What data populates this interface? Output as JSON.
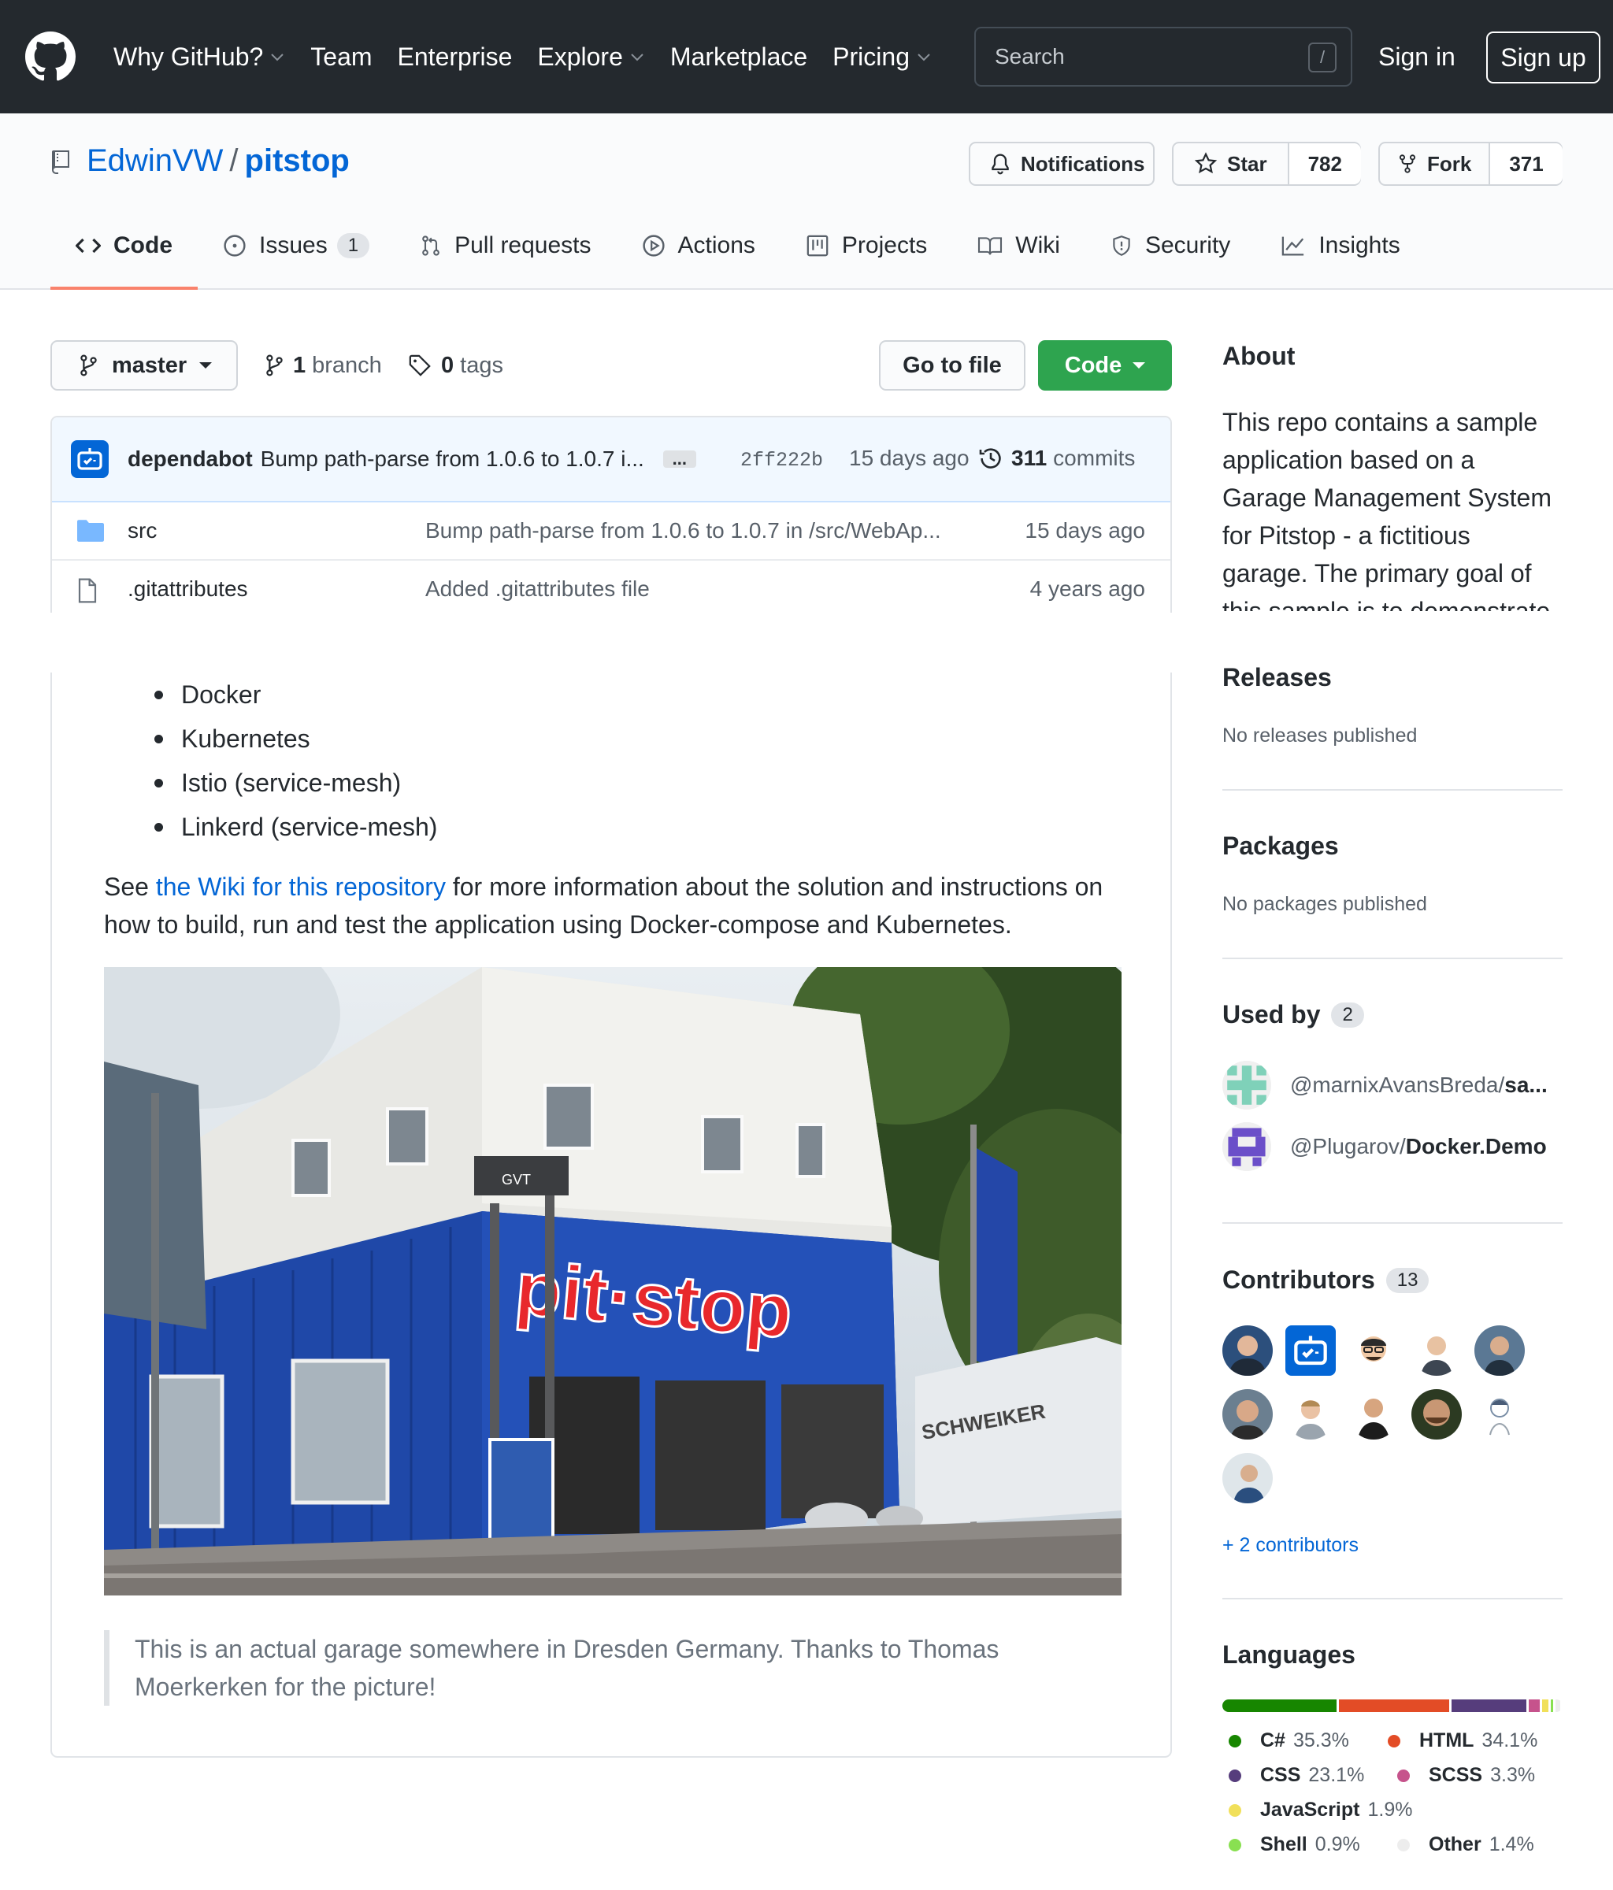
{
  "header": {
    "nav": [
      {
        "label": "Why GitHub?",
        "dropdown": true
      },
      {
        "label": "Team",
        "dropdown": false
      },
      {
        "label": "Enterprise",
        "dropdown": false
      },
      {
        "label": "Explore",
        "dropdown": true
      },
      {
        "label": "Marketplace",
        "dropdown": false
      },
      {
        "label": "Pricing",
        "dropdown": true
      }
    ],
    "search_placeholder": "Search",
    "search_shortcut": "/",
    "sign_in": "Sign in",
    "sign_up": "Sign up"
  },
  "repo": {
    "owner": "EdwinVW",
    "separator": "/",
    "name": "pitstop",
    "notifications_label": "Notifications",
    "star_label": "Star",
    "star_count": "782",
    "fork_label": "Fork",
    "fork_count": "371"
  },
  "tabs": [
    {
      "label": "Code",
      "icon": "code-icon"
    },
    {
      "label": "Issues",
      "icon": "issue-icon",
      "counter": "1"
    },
    {
      "label": "Pull requests",
      "icon": "pull-request-icon"
    },
    {
      "label": "Actions",
      "icon": "play-icon"
    },
    {
      "label": "Projects",
      "icon": "project-icon"
    },
    {
      "label": "Wiki",
      "icon": "book-icon"
    },
    {
      "label": "Security",
      "icon": "shield-icon"
    },
    {
      "label": "Insights",
      "icon": "graph-icon"
    }
  ],
  "branch_bar": {
    "branch": "master",
    "branch_count": "1",
    "branch_word": "branch",
    "tag_count": "0",
    "tag_word": "tags",
    "goto_file": "Go to file",
    "code_button": "Code"
  },
  "latest_commit": {
    "author": "dependabot",
    "message": "Bump path-parse from 1.0.6 to 1.0.7 i...",
    "ellipsis": "...",
    "sha": "2ff222b",
    "time": "15 days ago",
    "commit_count": "311",
    "commit_word": "commits"
  },
  "files": [
    {
      "type": "folder",
      "name": "src",
      "message": "Bump path-parse from 1.0.6 to 1.0.7 in /src/WebAp...",
      "age": "15 days ago"
    },
    {
      "type": "file",
      "name": ".gitattributes",
      "message": "Added .gitattributes file",
      "age": "4 years ago"
    }
  ],
  "readme": {
    "list": [
      "Docker",
      "Kubernetes",
      "Istio (service-mesh)",
      "Linkerd (service-mesh)"
    ],
    "para_before": "See ",
    "para_link": "the Wiki for this repository",
    "para_after": " for more information about the solution and instructions on how to build, run and test the application using Docker-compose and Kubernetes.",
    "photo_sign": "pit·stop",
    "photo_truck": "SCHWEIKER",
    "photo_box": "GVT",
    "quote": "This is an actual garage somewhere in Dresden Germany. Thanks to Thomas Moerkerken for the picture!"
  },
  "sidebar": {
    "about_title": "About",
    "about_text": "This repo contains a sample application based on a Garage Management System for Pitstop - a fictitious garage. The primary goal of this sample is to demonstrate",
    "releases_title": "Releases",
    "releases_empty": "No releases published",
    "packages_title": "Packages",
    "packages_empty": "No packages published",
    "usedby_title": "Used by",
    "usedby_count": "2",
    "usedby": [
      {
        "owner": "@marnixAvansBreda",
        "sep": " / ",
        "repo": "sa..."
      },
      {
        "owner": "@Plugarov",
        "sep": " / ",
        "repo": "Docker.Demo"
      }
    ],
    "contributors_title": "Contributors",
    "contributors_count": "13",
    "more_contributors": "+ 2 contributors",
    "languages_title": "Languages",
    "languages": [
      {
        "name": "C#",
        "percent": "35.3%",
        "value": 35.3,
        "color": "#178600"
      },
      {
        "name": "HTML",
        "percent": "34.1%",
        "value": 34.1,
        "color": "#e34c26"
      },
      {
        "name": "CSS",
        "percent": "23.1%",
        "value": 23.1,
        "color": "#563d7c"
      },
      {
        "name": "SCSS",
        "percent": "3.3%",
        "value": 3.3,
        "color": "#c6538c"
      },
      {
        "name": "JavaScript",
        "percent": "1.9%",
        "value": 1.9,
        "color": "#f1e05a"
      },
      {
        "name": "Shell",
        "percent": "0.9%",
        "value": 0.9,
        "color": "#89e051"
      },
      {
        "name": "Other",
        "percent": "1.4%",
        "value": 1.4,
        "color": "#ededed"
      }
    ]
  }
}
